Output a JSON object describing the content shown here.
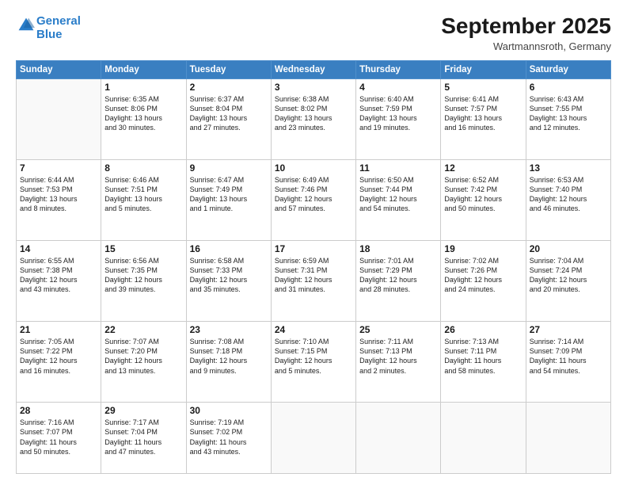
{
  "logo": {
    "line1": "General",
    "line2": "Blue"
  },
  "title": "September 2025",
  "location": "Wartmannsroth, Germany",
  "days_header": [
    "Sunday",
    "Monday",
    "Tuesday",
    "Wednesday",
    "Thursday",
    "Friday",
    "Saturday"
  ],
  "weeks": [
    [
      {
        "day": "",
        "content": ""
      },
      {
        "day": "1",
        "content": "Sunrise: 6:35 AM\nSunset: 8:06 PM\nDaylight: 13 hours\nand 30 minutes."
      },
      {
        "day": "2",
        "content": "Sunrise: 6:37 AM\nSunset: 8:04 PM\nDaylight: 13 hours\nand 27 minutes."
      },
      {
        "day": "3",
        "content": "Sunrise: 6:38 AM\nSunset: 8:02 PM\nDaylight: 13 hours\nand 23 minutes."
      },
      {
        "day": "4",
        "content": "Sunrise: 6:40 AM\nSunset: 7:59 PM\nDaylight: 13 hours\nand 19 minutes."
      },
      {
        "day": "5",
        "content": "Sunrise: 6:41 AM\nSunset: 7:57 PM\nDaylight: 13 hours\nand 16 minutes."
      },
      {
        "day": "6",
        "content": "Sunrise: 6:43 AM\nSunset: 7:55 PM\nDaylight: 13 hours\nand 12 minutes."
      }
    ],
    [
      {
        "day": "7",
        "content": "Sunrise: 6:44 AM\nSunset: 7:53 PM\nDaylight: 13 hours\nand 8 minutes."
      },
      {
        "day": "8",
        "content": "Sunrise: 6:46 AM\nSunset: 7:51 PM\nDaylight: 13 hours\nand 5 minutes."
      },
      {
        "day": "9",
        "content": "Sunrise: 6:47 AM\nSunset: 7:49 PM\nDaylight: 13 hours\nand 1 minute."
      },
      {
        "day": "10",
        "content": "Sunrise: 6:49 AM\nSunset: 7:46 PM\nDaylight: 12 hours\nand 57 minutes."
      },
      {
        "day": "11",
        "content": "Sunrise: 6:50 AM\nSunset: 7:44 PM\nDaylight: 12 hours\nand 54 minutes."
      },
      {
        "day": "12",
        "content": "Sunrise: 6:52 AM\nSunset: 7:42 PM\nDaylight: 12 hours\nand 50 minutes."
      },
      {
        "day": "13",
        "content": "Sunrise: 6:53 AM\nSunset: 7:40 PM\nDaylight: 12 hours\nand 46 minutes."
      }
    ],
    [
      {
        "day": "14",
        "content": "Sunrise: 6:55 AM\nSunset: 7:38 PM\nDaylight: 12 hours\nand 43 minutes."
      },
      {
        "day": "15",
        "content": "Sunrise: 6:56 AM\nSunset: 7:35 PM\nDaylight: 12 hours\nand 39 minutes."
      },
      {
        "day": "16",
        "content": "Sunrise: 6:58 AM\nSunset: 7:33 PM\nDaylight: 12 hours\nand 35 minutes."
      },
      {
        "day": "17",
        "content": "Sunrise: 6:59 AM\nSunset: 7:31 PM\nDaylight: 12 hours\nand 31 minutes."
      },
      {
        "day": "18",
        "content": "Sunrise: 7:01 AM\nSunset: 7:29 PM\nDaylight: 12 hours\nand 28 minutes."
      },
      {
        "day": "19",
        "content": "Sunrise: 7:02 AM\nSunset: 7:26 PM\nDaylight: 12 hours\nand 24 minutes."
      },
      {
        "day": "20",
        "content": "Sunrise: 7:04 AM\nSunset: 7:24 PM\nDaylight: 12 hours\nand 20 minutes."
      }
    ],
    [
      {
        "day": "21",
        "content": "Sunrise: 7:05 AM\nSunset: 7:22 PM\nDaylight: 12 hours\nand 16 minutes."
      },
      {
        "day": "22",
        "content": "Sunrise: 7:07 AM\nSunset: 7:20 PM\nDaylight: 12 hours\nand 13 minutes."
      },
      {
        "day": "23",
        "content": "Sunrise: 7:08 AM\nSunset: 7:18 PM\nDaylight: 12 hours\nand 9 minutes."
      },
      {
        "day": "24",
        "content": "Sunrise: 7:10 AM\nSunset: 7:15 PM\nDaylight: 12 hours\nand 5 minutes."
      },
      {
        "day": "25",
        "content": "Sunrise: 7:11 AM\nSunset: 7:13 PM\nDaylight: 12 hours\nand 2 minutes."
      },
      {
        "day": "26",
        "content": "Sunrise: 7:13 AM\nSunset: 7:11 PM\nDaylight: 11 hours\nand 58 minutes."
      },
      {
        "day": "27",
        "content": "Sunrise: 7:14 AM\nSunset: 7:09 PM\nDaylight: 11 hours\nand 54 minutes."
      }
    ],
    [
      {
        "day": "28",
        "content": "Sunrise: 7:16 AM\nSunset: 7:07 PM\nDaylight: 11 hours\nand 50 minutes."
      },
      {
        "day": "29",
        "content": "Sunrise: 7:17 AM\nSunset: 7:04 PM\nDaylight: 11 hours\nand 47 minutes."
      },
      {
        "day": "30",
        "content": "Sunrise: 7:19 AM\nSunset: 7:02 PM\nDaylight: 11 hours\nand 43 minutes."
      },
      {
        "day": "",
        "content": ""
      },
      {
        "day": "",
        "content": ""
      },
      {
        "day": "",
        "content": ""
      },
      {
        "day": "",
        "content": ""
      }
    ]
  ]
}
